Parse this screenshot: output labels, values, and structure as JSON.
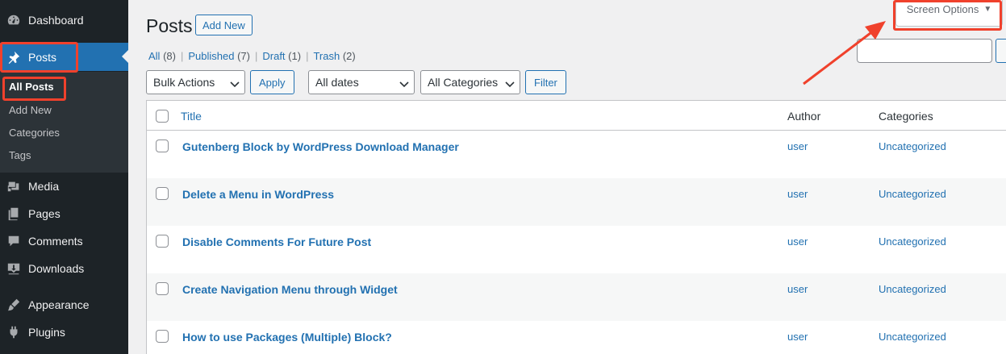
{
  "sidebar": {
    "items": [
      {
        "label": "Dashboard",
        "icon": "dashboard-icon"
      },
      {
        "label": "Posts",
        "icon": "pin-icon"
      },
      {
        "label": "Media",
        "icon": "media-icon"
      },
      {
        "label": "Pages",
        "icon": "pages-icon"
      },
      {
        "label": "Comments",
        "icon": "comments-icon"
      },
      {
        "label": "Downloads",
        "icon": "download-icon"
      },
      {
        "label": "Appearance",
        "icon": "brush-icon"
      },
      {
        "label": "Plugins",
        "icon": "plugin-icon"
      }
    ],
    "submenu": [
      "All Posts",
      "Add New",
      "Categories",
      "Tags"
    ]
  },
  "header": {
    "title": "Posts",
    "add_new": "Add New",
    "screen_options": "Screen Options",
    "screen_options_caret": "▼"
  },
  "views": [
    {
      "label": "All",
      "count": "(8)"
    },
    {
      "label": "Published",
      "count": "(7)"
    },
    {
      "label": "Draft",
      "count": "(1)"
    },
    {
      "label": "Trash",
      "count": "(2)"
    }
  ],
  "views_separator": "|",
  "filters": {
    "bulk_actions": "Bulk Actions",
    "apply": "Apply",
    "dates": "All dates",
    "categories": "All Categories",
    "filter": "Filter"
  },
  "table": {
    "columns": {
      "title": "Title",
      "author": "Author",
      "categories": "Categories"
    },
    "rows": [
      {
        "title": "Gutenberg Block by WordPress Download Manager",
        "author": "user",
        "category": "Uncategorized"
      },
      {
        "title": "Delete a Menu in WordPress",
        "author": "user",
        "category": "Uncategorized"
      },
      {
        "title": "Disable Comments For Future Post",
        "author": "user",
        "category": "Uncategorized"
      },
      {
        "title": "Create Navigation Menu through Widget",
        "author": "user",
        "category": "Uncategorized"
      },
      {
        "title": "How to use Packages (Multiple) Block?",
        "author": "user",
        "category": "Uncategorized"
      }
    ]
  },
  "colors": {
    "sidebar_bg": "#1d2327",
    "accent": "#2271b1",
    "annotation": "#f0412c"
  }
}
